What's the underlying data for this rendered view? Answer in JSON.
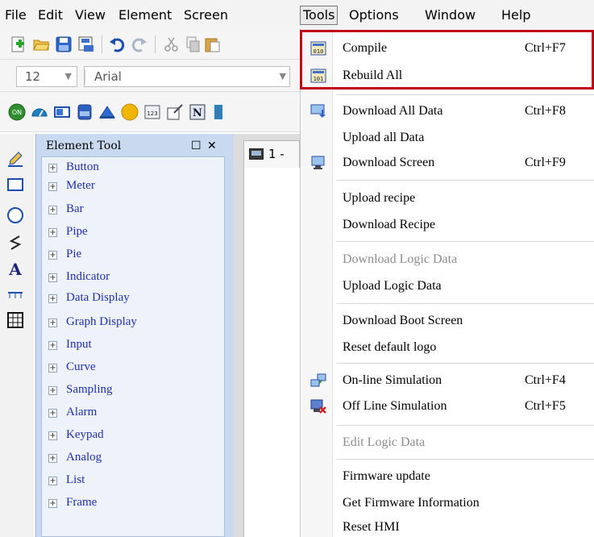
{
  "menubar": {
    "items": [
      "File",
      "Edit",
      "View",
      "Element",
      "Screen",
      "Tools",
      "Options",
      "Window",
      "Help"
    ]
  },
  "font_toolbar": {
    "size_value": "12",
    "font_value": "Arial"
  },
  "element_tool": {
    "title": "Element Tool",
    "items": [
      "Button",
      "Meter",
      "Bar",
      "Pipe",
      "Pie",
      "Indicator",
      "Data Display",
      "Graph Display",
      "Input",
      "Curve",
      "Sampling",
      "Alarm",
      "Keypad",
      "Analog",
      "List",
      "Frame"
    ]
  },
  "workspace": {
    "tab_label": "1 -"
  },
  "tools_menu": {
    "compile": {
      "label": "Compile",
      "shortcut": "Ctrl+F7"
    },
    "rebuild_all": {
      "label": "Rebuild All"
    },
    "download_all_data": {
      "label": "Download All Data",
      "shortcut": "Ctrl+F8"
    },
    "upload_all_data": {
      "label": "Upload all Data"
    },
    "download_screen": {
      "label": "Download Screen",
      "shortcut": "Ctrl+F9"
    },
    "upload_recipe": {
      "label": "Upload recipe"
    },
    "download_recipe": {
      "label": "Download Recipe"
    },
    "download_logic_data": {
      "label": "Download Logic Data",
      "enabled": false
    },
    "upload_logic_data": {
      "label": "Upload Logic Data"
    },
    "download_boot_screen": {
      "label": "Download Boot Screen"
    },
    "reset_default_logo": {
      "label": "Reset default logo"
    },
    "online_simulation": {
      "label": "On-line Simulation",
      "shortcut": "Ctrl+F4"
    },
    "offline_simulation": {
      "label": "Off Line Simulation",
      "shortcut": "Ctrl+F5"
    },
    "edit_logic_data": {
      "label": "Edit Logic Data",
      "enabled": false
    },
    "firmware_update": {
      "label": "Firmware update"
    },
    "get_firmware_info": {
      "label": "Get Firmware Information"
    },
    "reset_hmi": {
      "label": "Reset HMI"
    }
  },
  "colors": {
    "highlight": "#c00018",
    "element_link": "#1f2fb0",
    "panel_bg": "#c9d9f0"
  }
}
